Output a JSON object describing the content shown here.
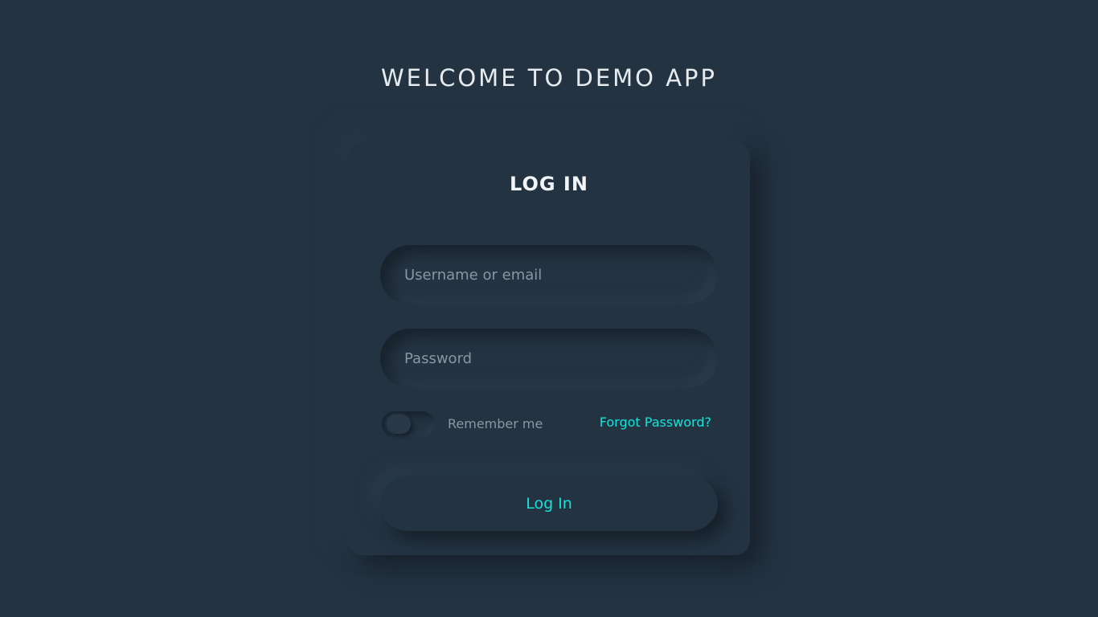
{
  "header": {
    "app_title": "WELCOME TO DEMO APP"
  },
  "login_form": {
    "title": "LOG IN",
    "username_placeholder": "Username or email",
    "password_placeholder": "Password",
    "remember_label": "Remember me",
    "remember_checked": false,
    "forgot_password_label": "Forgot Password?",
    "submit_label": "Log In"
  },
  "colors": {
    "background": "#243342",
    "accent": "#17e0d8",
    "title_text": "#e6ebef",
    "muted_text": "#8a96a1"
  }
}
